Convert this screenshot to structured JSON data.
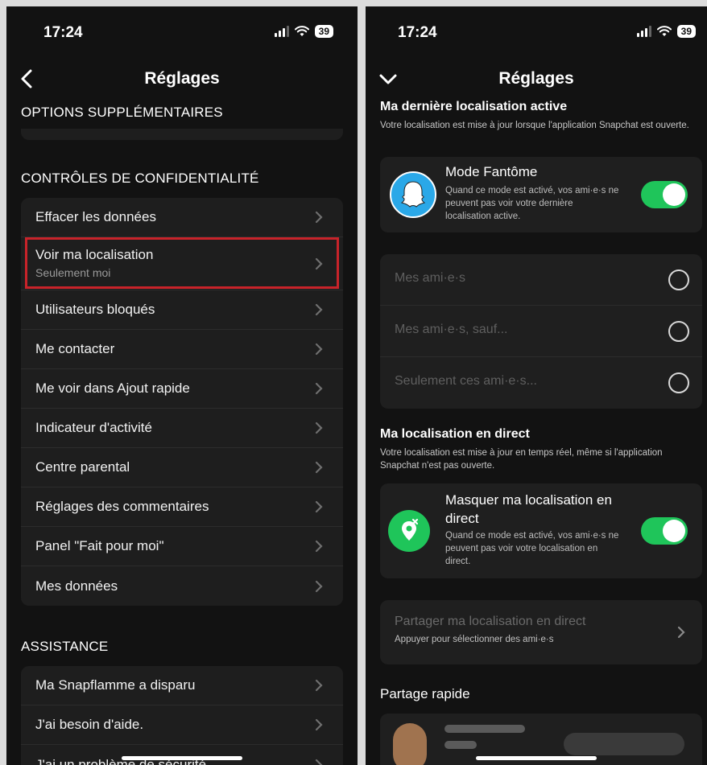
{
  "left": {
    "time": "17:24",
    "battery": "39",
    "title": "Réglages",
    "sections": {
      "options": "OPTIONS SUPPLÉMENTAIRES",
      "privacy": "CONTRÔLES DE CONFIDENTIALITÉ",
      "support": "ASSISTANCE"
    },
    "privacy_items": [
      {
        "label": "Effacer les données"
      },
      {
        "label": "Voir ma localisation",
        "sub": "Seulement moi"
      },
      {
        "label": "Utilisateurs bloqués"
      },
      {
        "label": "Me contacter"
      },
      {
        "label": "Me voir dans Ajout rapide"
      },
      {
        "label": "Indicateur d'activité"
      },
      {
        "label": "Centre parental"
      },
      {
        "label": "Réglages des commentaires"
      },
      {
        "label": "Panel \"Fait pour moi\""
      },
      {
        "label": "Mes données"
      }
    ],
    "support_items": [
      {
        "label": "Ma Snapflamme a disparu"
      },
      {
        "label": "J'ai besoin d'aide."
      },
      {
        "label": "J'ai un problème de sécurité"
      }
    ],
    "highlight_color": "#c8232a"
  },
  "right": {
    "time": "17:24",
    "battery": "39",
    "title": "Réglages",
    "last_location": {
      "title": "Ma dernière localisation active",
      "desc": "Votre localisation est mise à jour lorsque l'application Snapchat est ouverte."
    },
    "ghost_mode": {
      "title": "Mode Fantôme",
      "desc": "Quand ce mode est activé, vos ami·e·s ne peuvent pas voir votre dernière localisation active.",
      "enabled": true
    },
    "audience_options": [
      "Mes ami·e·s",
      "Mes ami·e·s, sauf...",
      "Seulement ces ami·e·s..."
    ],
    "live_location": {
      "title": "Ma localisation en direct",
      "desc": "Votre localisation est mise à jour en temps réel, même si l'application Snapchat n'est pas ouverte."
    },
    "hide_live": {
      "title": "Masquer ma localisation en direct",
      "desc": "Quand ce mode est activé, vos ami·e·s ne peuvent pas voir votre localisation en direct.",
      "enabled": true
    },
    "share_live": {
      "title": "Partager ma localisation en direct",
      "sub": "Appuyer pour sélectionner des ami·e·s"
    },
    "quick_share": "Partage rapide",
    "toggle_color": "#1fc55a",
    "ghost_icon_color": "#2aa8e8",
    "live_icon_color": "#1fc55a"
  }
}
